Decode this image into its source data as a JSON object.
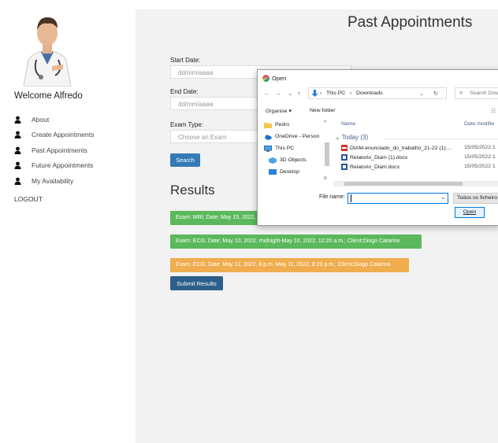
{
  "sidebar": {
    "welcome": "Welcome Alfredo",
    "items": [
      {
        "label": "About"
      },
      {
        "label": "Create Appointments"
      },
      {
        "label": "Past Appointments"
      },
      {
        "label": "Future Appointments"
      },
      {
        "label": "My Availability"
      }
    ],
    "logout": "LOGOUT"
  },
  "main": {
    "title": "Past Appointments",
    "start_date": {
      "label": "Start Date:",
      "placeholder": "dd/mm/aaaa"
    },
    "end_date": {
      "label": "End Date:",
      "placeholder": "dd/mm/aaaa"
    },
    "exam_type": {
      "label": "Exam Type:",
      "placeholder": "Choose an Exam"
    },
    "search_label": "Search",
    "results_title": "Results",
    "results": [
      {
        "text": "Exam: MRI; Date: May 15, 2022,",
        "status": "green"
      },
      {
        "text": "Exam: ECG; Date: May 10, 2022, midnight-May 10, 2022, 12:20 a.m.; Client:Diogo Catarino",
        "status": "green"
      },
      {
        "text": "Exam: ECG; Date: May 11, 2022, 8 p.m.-May 11, 2022, 8:20 p.m.; Client:Diogo Catarino",
        "status": "orange"
      }
    ],
    "submit_label": "Submit Results"
  },
  "dialog": {
    "title": "Open",
    "breadcrumb": [
      "This PC",
      "Downloads"
    ],
    "search_placeholder": "Search Dow",
    "organise": "Organise ▾",
    "new_folder": "New folder",
    "tree": [
      {
        "label": "Pedro",
        "icon": "folder-icon"
      },
      {
        "label": "OneDrive - Person",
        "icon": "onedrive-icon"
      },
      {
        "label": "This PC",
        "icon": "pc-icon"
      },
      {
        "label": "3D Objects",
        "icon": "3d-objects-icon"
      },
      {
        "label": "Desktop",
        "icon": "desktop-icon"
      }
    ],
    "columns": {
      "name": "Name",
      "date": "Date modifie"
    },
    "group": "Today (3)",
    "files": [
      {
        "name": "DIAM-enunciado_do_trabalho_21-22 (1)....",
        "date": "15/05/2022 1",
        "type": "pdf"
      },
      {
        "name": "Relatorio_Diam (1).docx",
        "date": "15/05/2022 1",
        "type": "docx"
      },
      {
        "name": "Relatorio_Diam.docx",
        "date": "15/05/2022 1",
        "type": "docx"
      }
    ],
    "file_name_label": "File name:",
    "file_name_value": "",
    "file_type": "Todos os ficheiro",
    "open_label": "Open"
  },
  "colors": {
    "accent": "#337ab7",
    "success": "#5cb85c",
    "warning": "#f0ad4e",
    "submit": "#2e5f8a"
  }
}
